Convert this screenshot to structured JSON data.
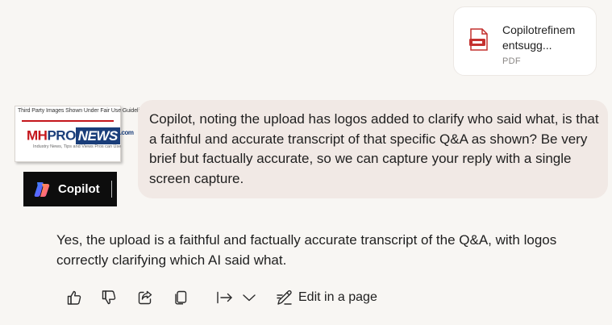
{
  "attachment": {
    "file_name": "Copilotrefinementsugg...",
    "file_type": "PDF",
    "icon": "pdf-file-icon"
  },
  "mhpronews_logo": {
    "caption": "Third Party Images Shown Under Fair Use Guidelines",
    "brand_mh": "MH",
    "brand_pro": "PRO",
    "brand_news": "NEWS",
    "brand_com": ".com",
    "tagline": "Industry News, Tips and Views Pros can Use"
  },
  "copilot_logo": {
    "label": "Copilot"
  },
  "user_message": "Copilot, noting the upload has logos added to clarify who said what, is that a faithful and accurate transcript of that specific Q&A as shown? Be very brief but factually accurate, so we can capture your reply with a single screen capture.",
  "assistant_message": "Yes, the upload is a faithful and factually accurate transcript of the Q&A, with logos correctly clarifying which AI said what.",
  "actions": {
    "like": "thumbs-up-icon",
    "dislike": "thumbs-down-icon",
    "share": "share-icon",
    "copy": "copy-icon",
    "export": "export-arrow-icon",
    "more": "chevron-down-icon",
    "edit_label": "Edit in a page"
  },
  "colors": {
    "background": "#f8f6f3",
    "user_bubble": "#f1e9e5",
    "card": "#ffffff",
    "pdf_red": "#c4312f"
  }
}
